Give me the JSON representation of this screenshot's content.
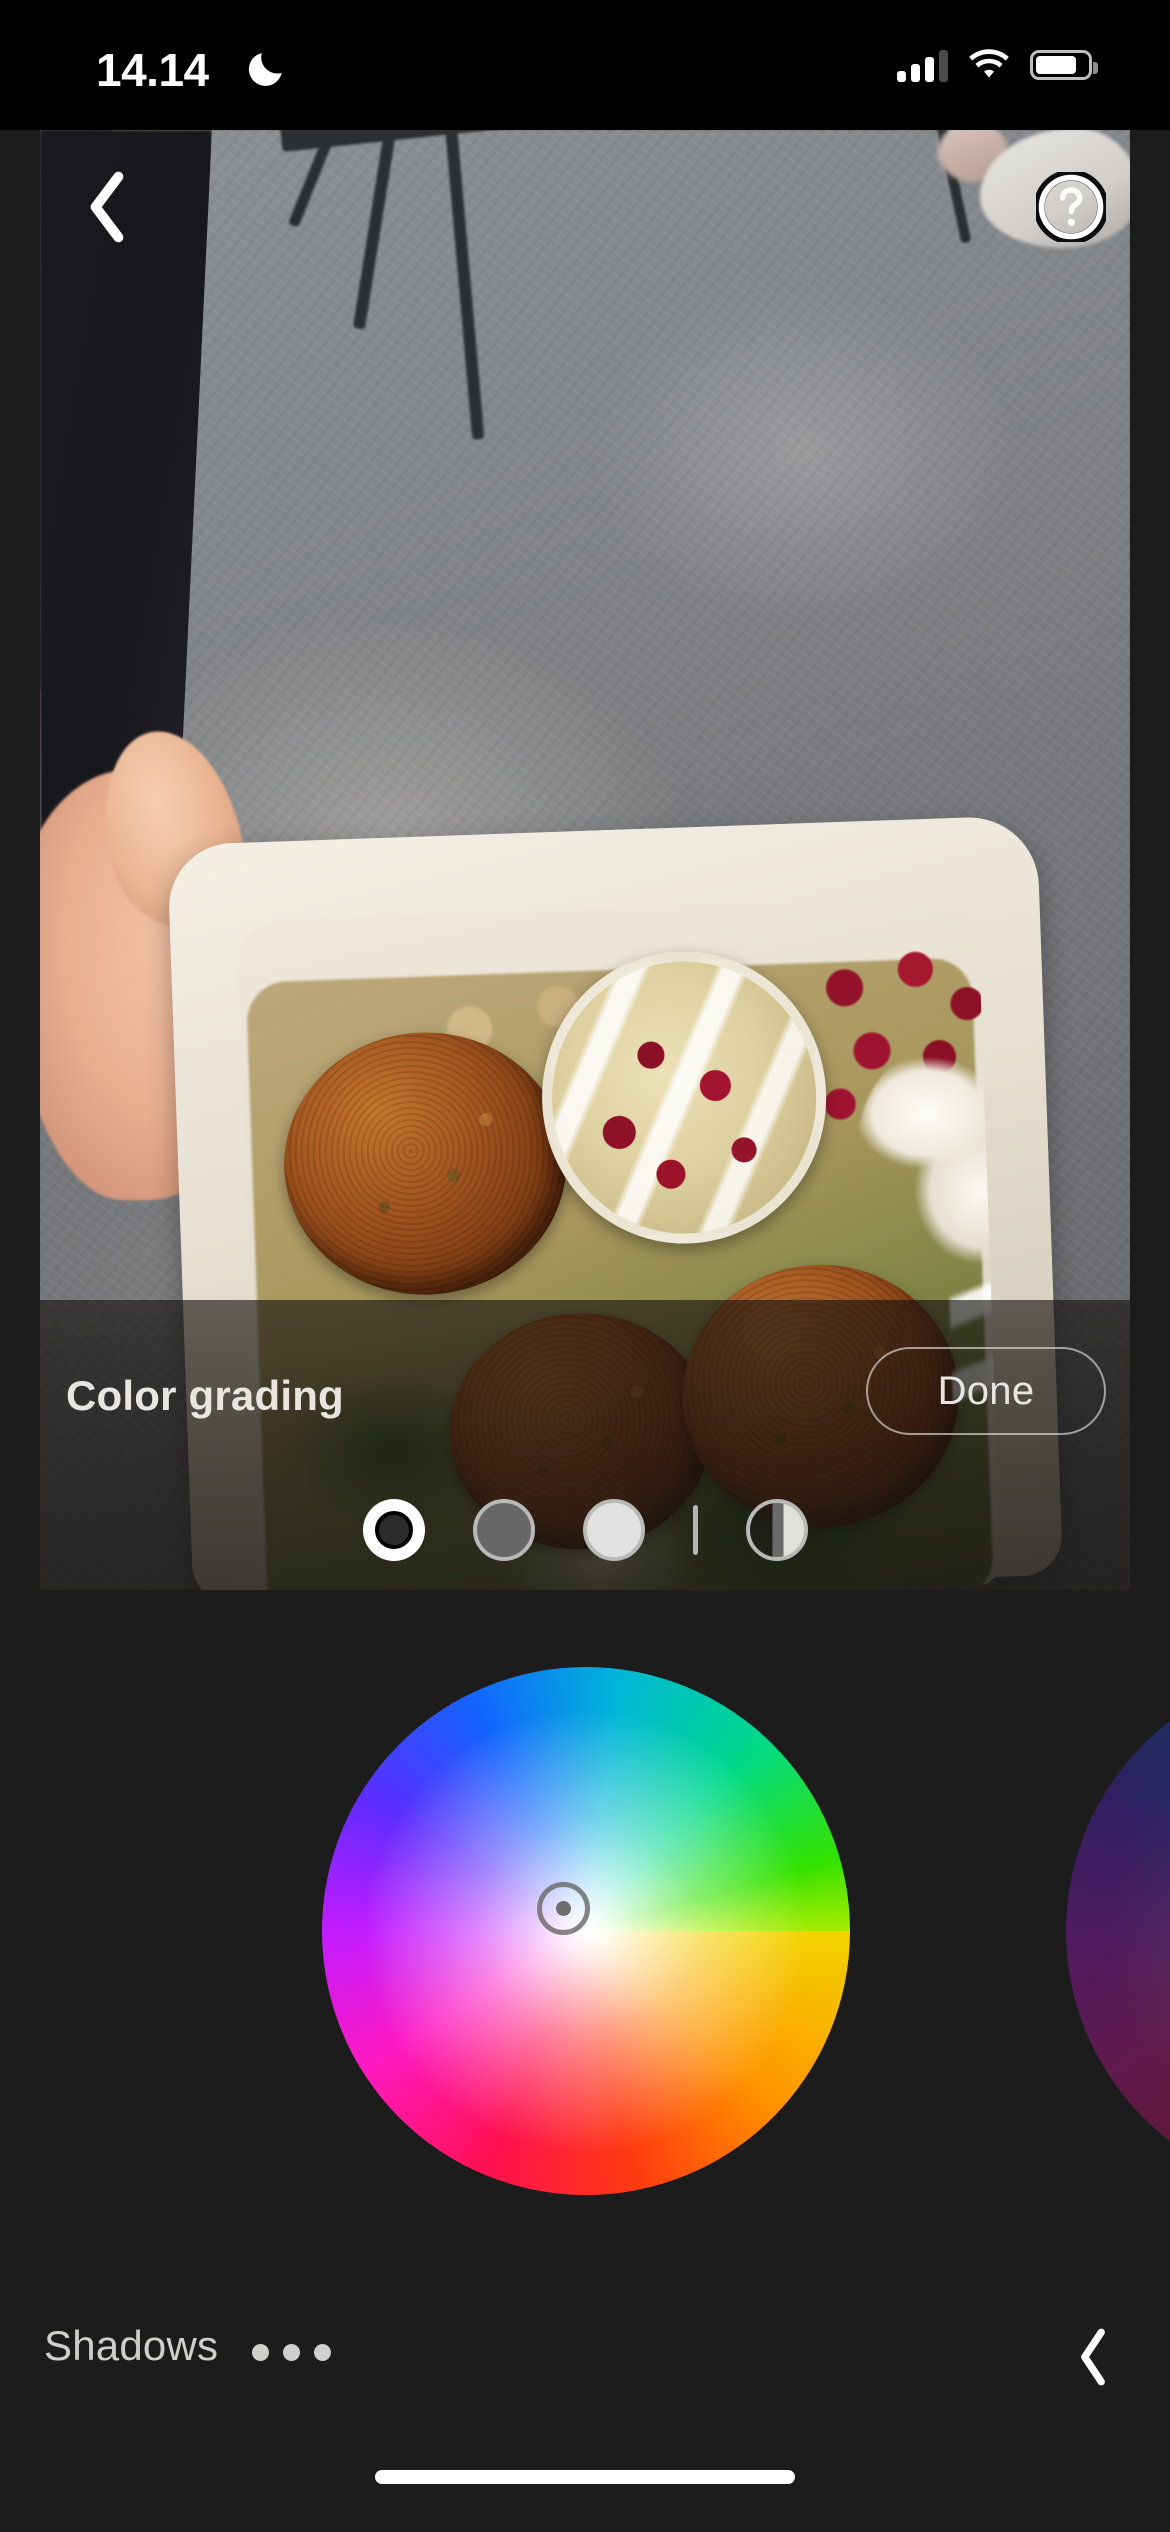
{
  "status_bar": {
    "time": "14.14",
    "dnd_icon": "crescent-moon-icon",
    "cellular_icon": "cellular-signal-icon",
    "cellular_bars_filled": 3,
    "cellular_bars_total": 4,
    "wifi_icon": "wifi-icon",
    "battery_icon": "battery-icon",
    "battery_level_percent": 80
  },
  "photo": {
    "back_icon": "chevron-left-icon",
    "help_icon": "question-mark-circle-icon",
    "subject": "falafel-bowl-takeaway-container"
  },
  "toolbar": {
    "title": "Color grading",
    "done_label": "Done",
    "tone_swatches": [
      {
        "name": "shadows-swatch",
        "selected": true
      },
      {
        "name": "midtones-swatch",
        "selected": false
      },
      {
        "name": "highlights-swatch",
        "selected": false
      },
      {
        "name": "divider",
        "selected": false
      },
      {
        "name": "balance-swatch",
        "selected": false
      }
    ]
  },
  "color_wheel": {
    "active_wheel_icon": "hue-saturation-wheel",
    "picker_icon": "wheel-picker-handle",
    "next_wheel_icon": "hue-saturation-wheel-dimmed"
  },
  "bottom_bar": {
    "tone_name": "Shadows",
    "more_options_icon": "ellipsis-icon",
    "prev_wheel_icon": "chevron-left-icon"
  },
  "home_indicator": {
    "icon": "home-indicator-bar"
  },
  "colors": {
    "app_background": "#1c1c1c",
    "status_bar_background": "#000000",
    "primary_text": "#e9e6e2",
    "secondary_text": "#cfcfcd",
    "accent_white": "#ffffff"
  }
}
